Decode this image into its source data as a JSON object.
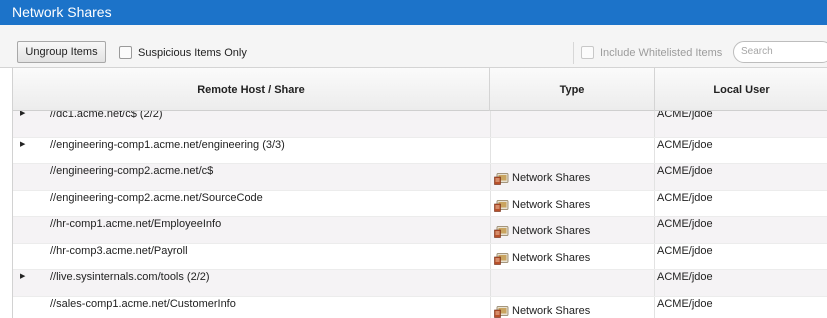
{
  "window": {
    "title": "Network Shares"
  },
  "toolbar": {
    "ungroup_label": "Ungroup Items",
    "suspicious_label": "Suspicious Items Only",
    "whitelist_label": "Include Whitelisted Items",
    "search_placeholder": "Search"
  },
  "table": {
    "columns": [
      "Remote Host / Share",
      "Type",
      "Local User"
    ],
    "rows": [
      {
        "expandable": true,
        "host": "//dc1.acme.net/c$ (2/2)",
        "type": "",
        "user": "ACME/jdoe"
      },
      {
        "expandable": true,
        "host": "//engineering-comp1.acme.net/engineering (3/3)",
        "type": "",
        "user": "ACME/jdoe"
      },
      {
        "expandable": false,
        "host": "//engineering-comp2.acme.net/c$",
        "type": "Network Shares",
        "user": "ACME/jdoe"
      },
      {
        "expandable": false,
        "host": "//engineering-comp2.acme.net/SourceCode",
        "type": "Network Shares",
        "user": "ACME/jdoe"
      },
      {
        "expandable": false,
        "host": "//hr-comp1.acme.net/EmployeeInfo",
        "type": "Network Shares",
        "user": "ACME/jdoe"
      },
      {
        "expandable": false,
        "host": "//hr-comp3.acme.net/Payroll",
        "type": "Network Shares",
        "user": "ACME/jdoe"
      },
      {
        "expandable": true,
        "host": "//live.sysinternals.com/tools (2/2)",
        "type": "",
        "user": "ACME/jdoe"
      },
      {
        "expandable": false,
        "host": "//sales-comp1.acme.net/CustomerInfo",
        "type": "Network Shares",
        "user": "ACME/jdoe"
      }
    ]
  },
  "colors": {
    "titlebar": "#1c73c9",
    "row_alt": "#f5f3f5"
  },
  "icons": {
    "expand": "triangle-right-icon",
    "type": "network-share-icon"
  }
}
